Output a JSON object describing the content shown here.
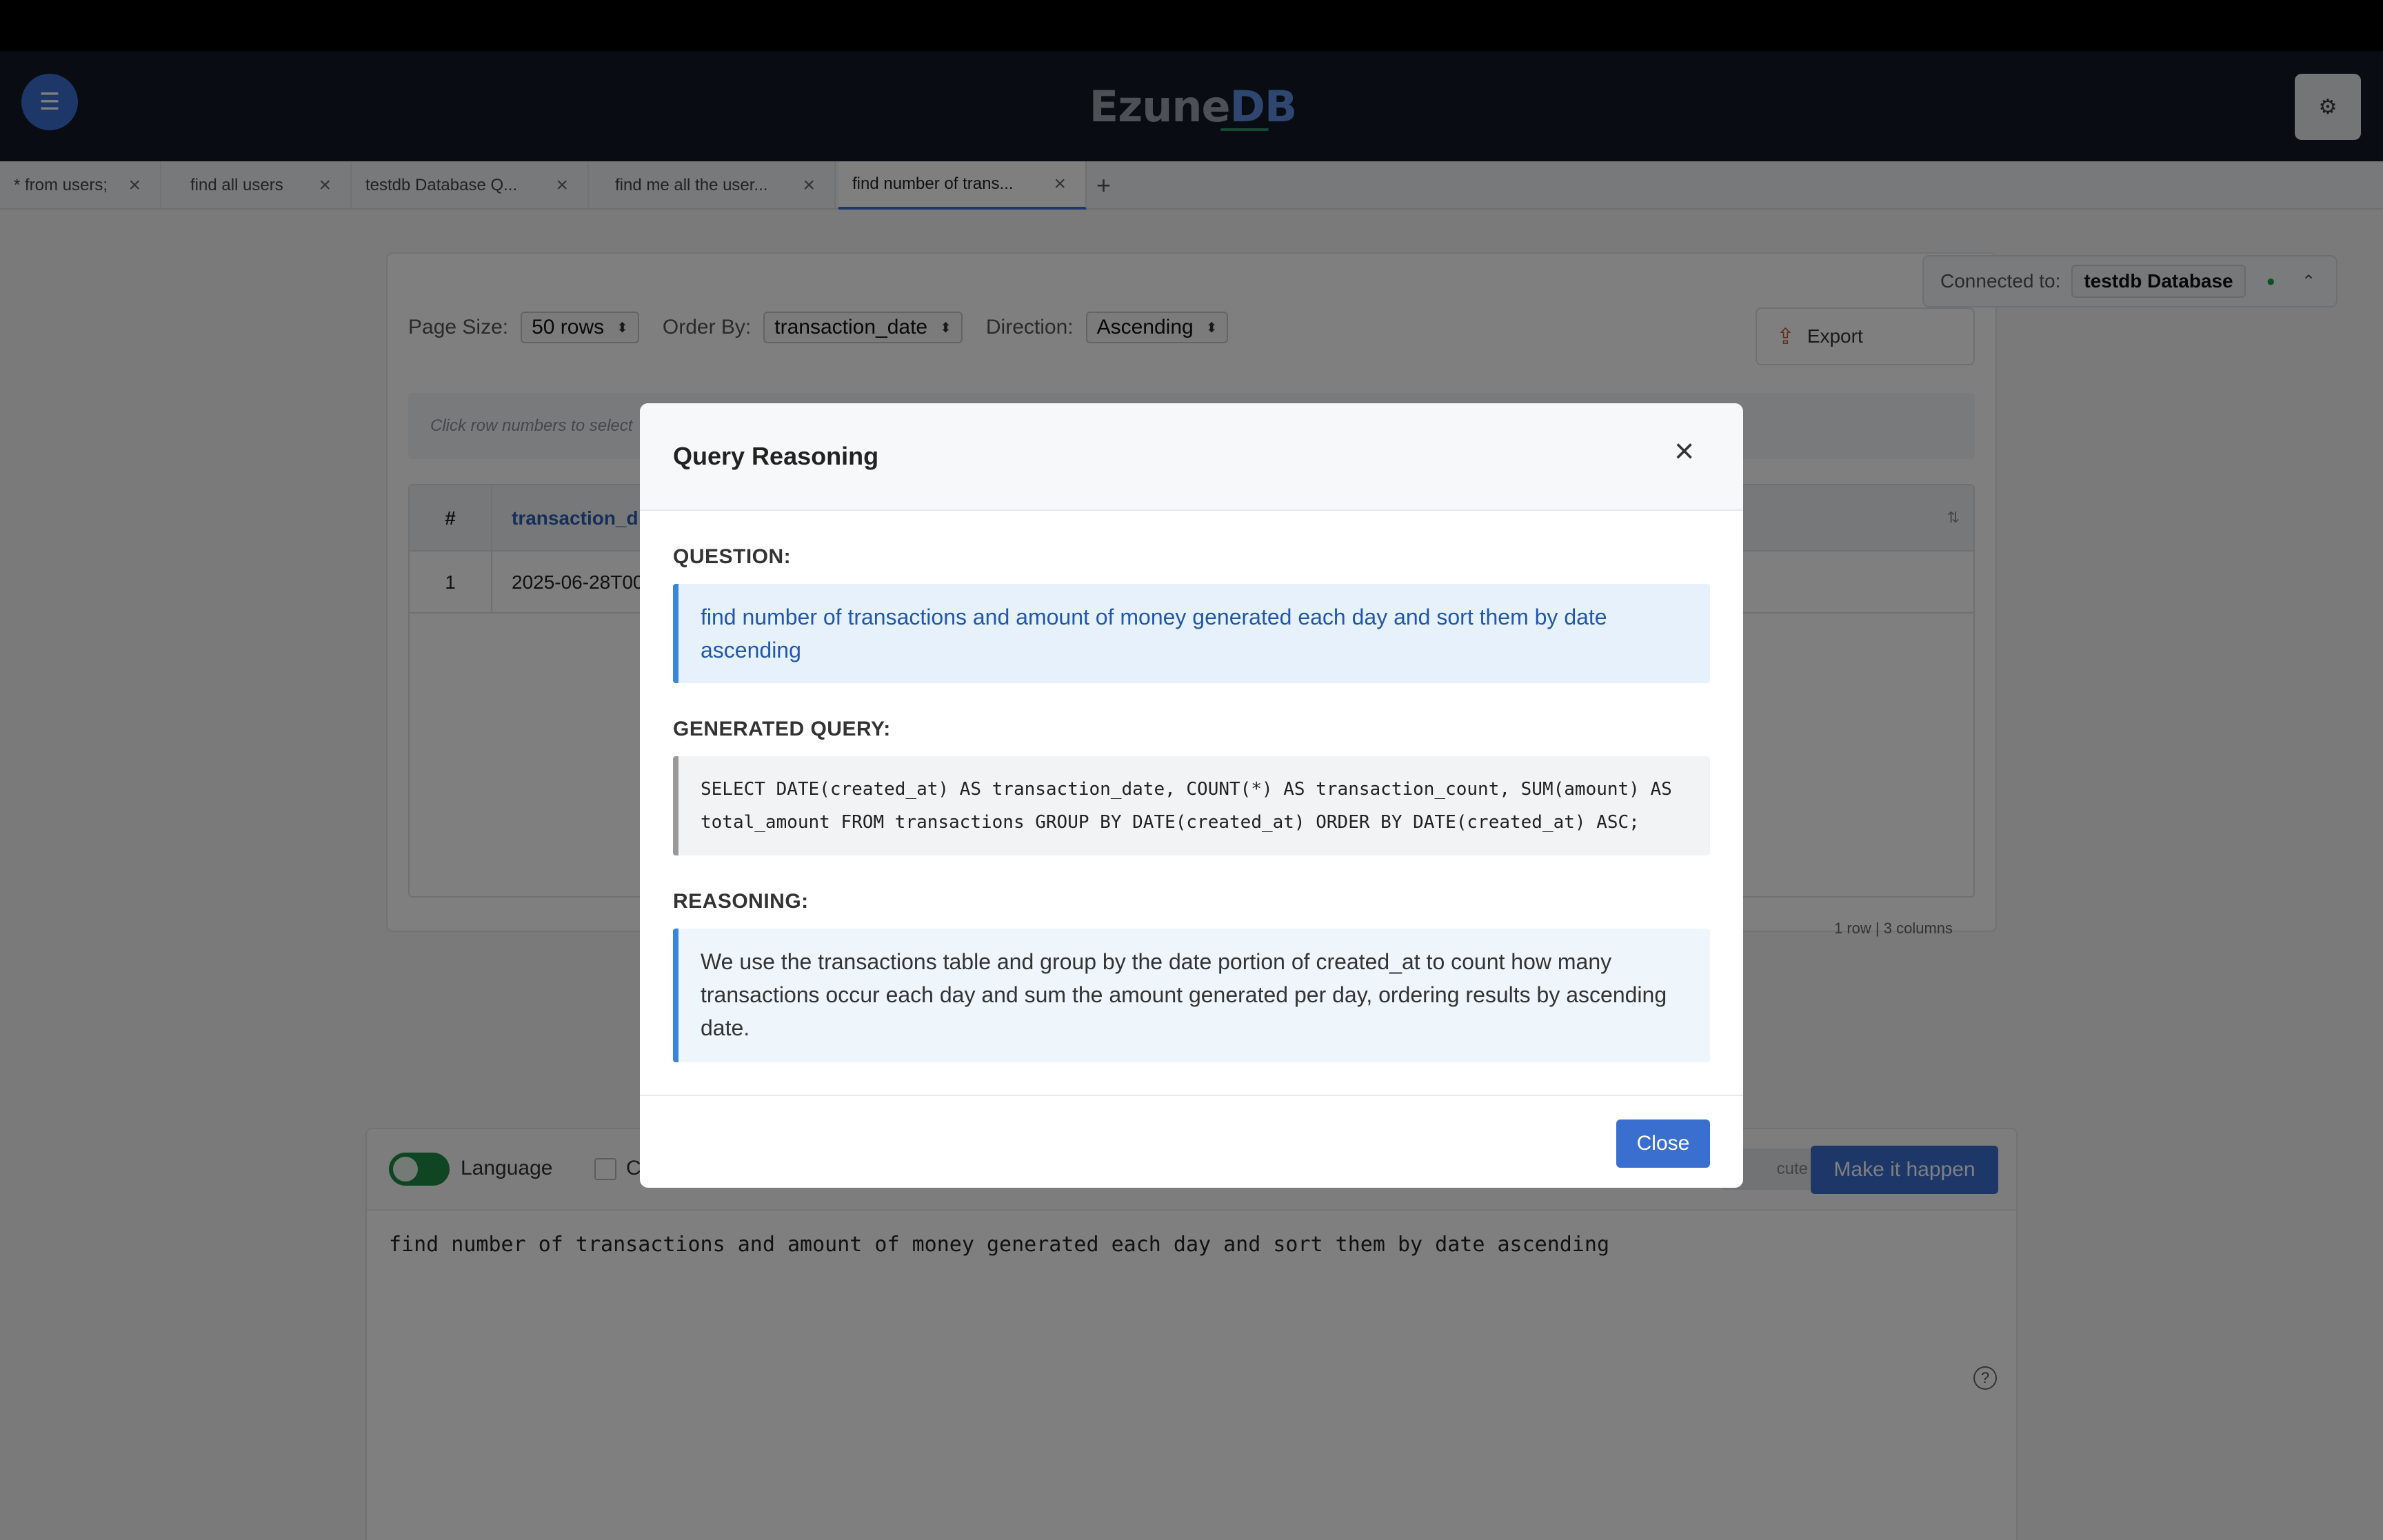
{
  "app": {
    "logo_main": "Ezune",
    "logo_accent": "DB"
  },
  "tabs": [
    {
      "label": "* from users;"
    },
    {
      "label": "find all users"
    },
    {
      "label": "testdb Database Q..."
    },
    {
      "label": "find me all the user..."
    },
    {
      "label": "find number of trans..."
    }
  ],
  "tab_add": "+",
  "connection": {
    "label": "Connected to:",
    "database": "testdb Database"
  },
  "controls": {
    "page_size_label": "Page Size:",
    "page_size_value": "50 rows",
    "order_by_label": "Order By:",
    "order_by_value": "transaction_date",
    "direction_label": "Direction:",
    "direction_value": "Ascending",
    "export_label": "Export"
  },
  "results": {
    "hint": "Click row numbers to select",
    "header_num": "#",
    "header_col": "transaction_d",
    "rows": [
      {
        "num": "1",
        "value": "2025-06-28T00"
      }
    ],
    "count_text": "1 row | 3 columns"
  },
  "editor": {
    "language_label": "Language",
    "checkbox_label": "C",
    "execute_label": "cute",
    "make_label": "Make it happen",
    "text": "find number of transactions and amount of money generated each day and sort them by date ascending"
  },
  "modal": {
    "title": "Query Reasoning",
    "question_label": "QUESTION:",
    "question": "find number of transactions and amount of money generated each day and sort them by date ascending",
    "query_label": "GENERATED QUERY:",
    "query_line1": "SELECT DATE(created_at) AS transaction_date, COUNT(*) AS transaction_count, SUM(amount) AS",
    "query_line2": "total_amount FROM transactions GROUP BY DATE(created_at) ORDER BY DATE(created_at) ASC;",
    "reasoning_label": "REASONING:",
    "reasoning": "We use the transactions table and group by the date portion of created_at to count how many transactions occur each day and sum the amount generated per day, ordering results by ascending date.",
    "close_label": "Close"
  }
}
